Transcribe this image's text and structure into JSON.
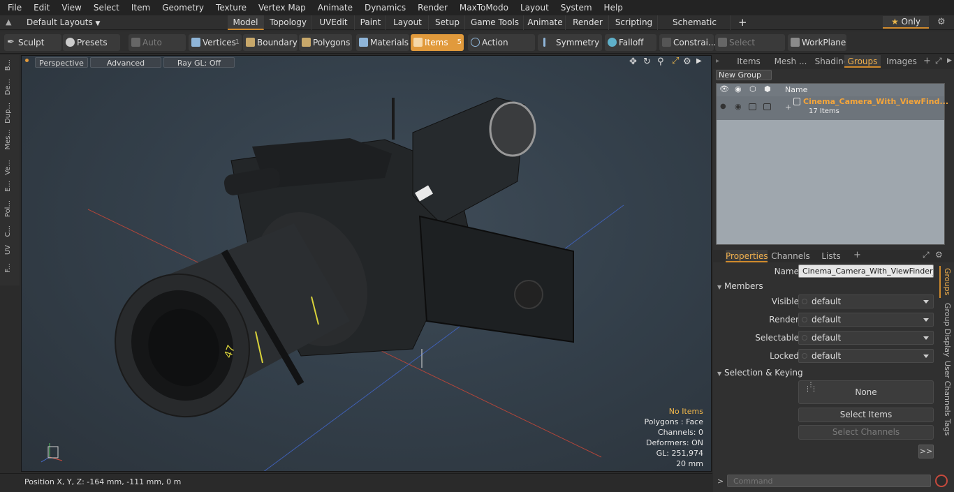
{
  "menu": [
    "File",
    "Edit",
    "View",
    "Select",
    "Item",
    "Geometry",
    "Texture",
    "Vertex Map",
    "Animate",
    "Dynamics",
    "Render",
    "MaxToModo",
    "Layout",
    "System",
    "Help"
  ],
  "layouts_label": "Default Layouts",
  "layout_tabs": [
    "Model",
    "Topology",
    "UVEdit",
    "Paint",
    "Layout",
    "Setup",
    "Game Tools",
    "Animate",
    "Render",
    "Scripting",
    "Schematic Fusion"
  ],
  "only_label": "Only",
  "toolbar": {
    "sculpt": "Sculpt",
    "presets": "Presets",
    "auto_select": "Auto Select",
    "vertices": "Vertices",
    "vertices_count": "1",
    "boundary": "Boundary",
    "polygons": "Polygons",
    "materials": "Materials",
    "items": "Items",
    "items_count": "5",
    "action_center": "Action Center",
    "symmetry": "Symmetry",
    "falloff": "Falloff",
    "constraints": "Constrai...",
    "select_through": "Select Through",
    "workplane": "WorkPlane"
  },
  "left_tabs": [
    "B...",
    "De...",
    "Dup...",
    "Mes...",
    "Ve...",
    "E...",
    "Pol...",
    "C...",
    "UV",
    "F..."
  ],
  "viewport": {
    "view": "Perspective",
    "shading": "Advanced",
    "raygl": "Ray GL: Off",
    "hud": {
      "items": "No Items",
      "polygons": "Polygons : Face",
      "channels": "Channels: 0",
      "deformers": "Deformers: ON",
      "gl": "GL: 251,974",
      "size": "20 mm"
    }
  },
  "status": {
    "position": "Position X, Y, Z:   -164 mm, -111 mm, 0 m"
  },
  "right_tabs": [
    "Items",
    "Mesh ...",
    "Shading",
    "Groups",
    "Images"
  ],
  "groups": {
    "new_group": "New Group",
    "col_name": "Name",
    "group_name": "Cinema_Camera_With_ViewFind...",
    "group_count": "17 Items"
  },
  "properties": {
    "tabs": [
      "Properties",
      "Channels",
      "Lists"
    ],
    "name_label": "Name",
    "name_value": "Cinema_Camera_With_ViewFinder_CD",
    "members_label": "Members",
    "visible_label": "Visible",
    "visible_value": "default",
    "render_label": "Render",
    "render_value": "default",
    "selectable_label": "Selectable",
    "selectable_value": "default",
    "locked_label": "Locked",
    "locked_value": "default",
    "selection_keying_label": "Selection & Keying",
    "none_label": "None",
    "select_items": "Select Items",
    "select_channels": "Select Channels",
    "more": ">>"
  },
  "side_vtabs": [
    "Groups",
    "Group Display",
    "User Channels",
    "Tags"
  ],
  "command_placeholder": "Command",
  "colors": {
    "accent": "#e19a3c",
    "highlight": "#f0b04e",
    "warn": "#f2b84b"
  }
}
